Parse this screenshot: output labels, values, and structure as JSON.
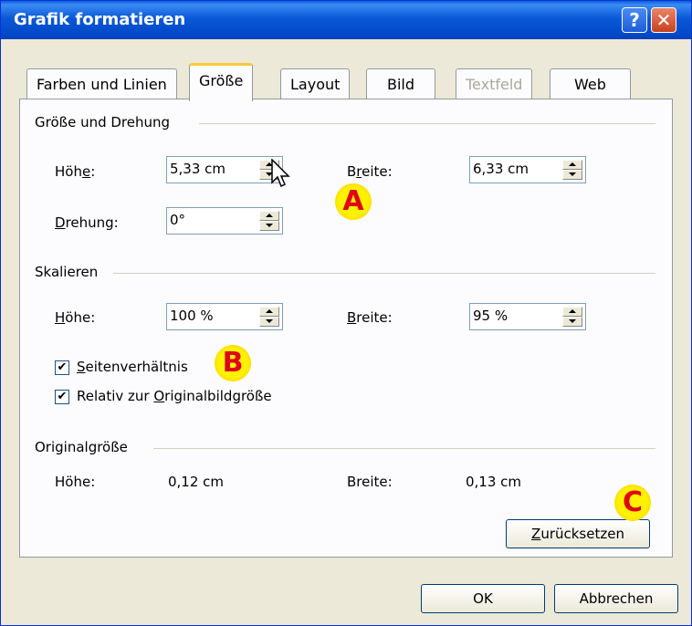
{
  "window": {
    "title": "Grafik formatieren",
    "help_glyph": "?",
    "close_glyph": "✕"
  },
  "tabs": [
    {
      "label": "Farben und Linien"
    },
    {
      "label": "Größe"
    },
    {
      "label": "Layout"
    },
    {
      "label": "Bild"
    },
    {
      "label": "Textfeld"
    },
    {
      "label": "Web"
    }
  ],
  "size_rotation": {
    "heading": "Größe und Drehung",
    "height_label_pre": "Höh",
    "height_label_u": "e",
    "height_label_post": ":",
    "height_value": "5,33 cm",
    "width_label_pre": "B",
    "width_label_u": "r",
    "width_label_post": "eite:",
    "width_value": "6,33 cm",
    "rotation_label_u": "D",
    "rotation_label_post": "rehung:",
    "rotation_value": "0°"
  },
  "scale": {
    "heading": "Skalieren",
    "height_label_u": "H",
    "height_label_post": "öhe:",
    "height_value": "100 %",
    "width_label_u": "B",
    "width_label_post": "reite:",
    "width_value": "95 %",
    "aspect_u": "S",
    "aspect_post": "eitenverhältnis",
    "aspect_checked": "✔",
    "relative_pre": "Relativ zur ",
    "relative_u": "O",
    "relative_post": "riginalbildgröße",
    "relative_checked": "✔"
  },
  "original": {
    "heading": "Originalgröße",
    "height_label": "Höhe:",
    "height_value": "0,12 cm",
    "width_label": "Breite:",
    "width_value": "0,13 cm",
    "reset_u": "Z",
    "reset_post": "urücksetzen"
  },
  "buttons": {
    "ok": "OK",
    "cancel": "Abbrechen"
  },
  "markers": {
    "a": "A",
    "b": "B",
    "c": "C"
  }
}
